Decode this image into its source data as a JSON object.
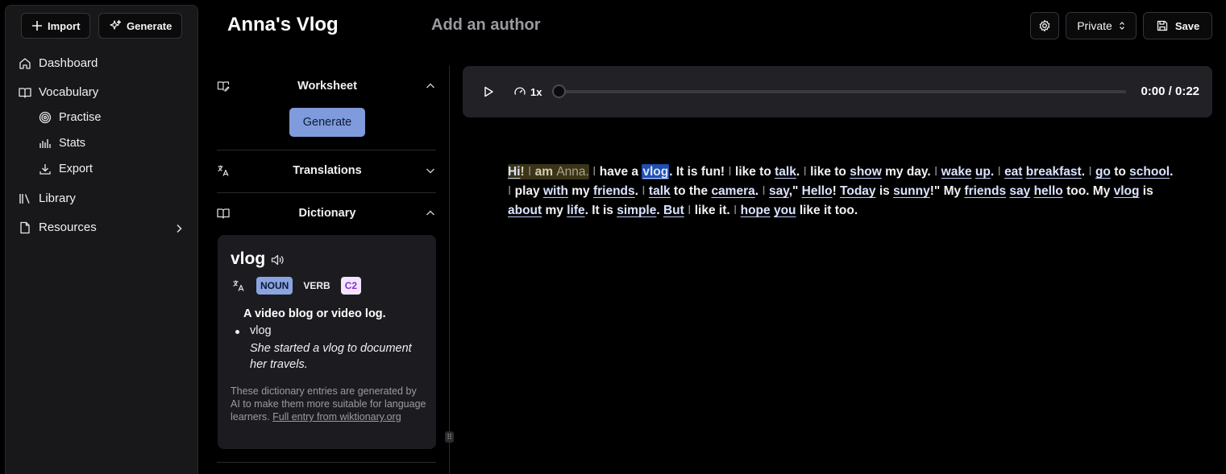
{
  "sidebar": {
    "import_label": "Import",
    "generate_label": "Generate",
    "items": [
      {
        "label": "Dashboard"
      },
      {
        "label": "Vocabulary"
      },
      {
        "label": "Practise"
      },
      {
        "label": "Stats"
      },
      {
        "label": "Export"
      },
      {
        "label": "Library"
      },
      {
        "label": "Resources"
      }
    ]
  },
  "header": {
    "title": "Anna's Vlog",
    "author_placeholder": "Add an author",
    "visibility": "Private",
    "save_label": "Save"
  },
  "panel": {
    "worksheet_label": "Worksheet",
    "worksheet_button": "Generate",
    "translations_label": "Translations",
    "dictionary_label": "Dictionary"
  },
  "dictionary": {
    "word": "vlog",
    "pos": [
      "NOUN",
      "VERB"
    ],
    "level": "C2",
    "definition": "A video blog or video log.",
    "example_word": "vlog",
    "example_sentence": "She started a vlog to document her travels.",
    "note": "These dictionary entries are generated by AI to make them more suitable for language learners. ",
    "link": "Full entry from wiktionary.org"
  },
  "player": {
    "speed": "1x",
    "progress": 0,
    "time": "0:00 / 0:22"
  },
  "colors": {
    "accent": "#7f9bdc",
    "level_badge": "#8b2bd6",
    "selected_word": "#1d4fb0",
    "highlight_segment": "#3a3418"
  },
  "transcript": [
    {
      "t": "Hi",
      "v": true,
      "hl": true
    },
    {
      "t": "! ",
      "hl": true
    },
    {
      "t": "I ",
      "sep": true,
      "hl": true
    },
    {
      "t": "am ",
      "hl": true
    },
    {
      "t": "Anna.",
      "hl": true,
      "dim": true
    },
    {
      "t": " "
    },
    {
      "t": "I ",
      "sep": true
    },
    {
      "t": "have a "
    },
    {
      "t": "vlog",
      "v": true,
      "sel": true
    },
    {
      "t": ". It is fun! "
    },
    {
      "t": "I ",
      "sep": true
    },
    {
      "t": "like to "
    },
    {
      "t": "talk",
      "v": true
    },
    {
      "t": ". "
    },
    {
      "t": "I ",
      "sep": true
    },
    {
      "t": "like to "
    },
    {
      "t": "show",
      "v": true
    },
    {
      "t": " my day. "
    },
    {
      "t": "I ",
      "sep": true
    },
    {
      "t": "wake",
      "v": true
    },
    {
      "t": " "
    },
    {
      "t": "up",
      "v": true
    },
    {
      "t": ". "
    },
    {
      "t": "I ",
      "sep": true
    },
    {
      "t": "eat",
      "v": true
    },
    {
      "t": " "
    },
    {
      "t": "breakfast",
      "v": true
    },
    {
      "t": ". "
    },
    {
      "t": "I ",
      "sep": true
    },
    {
      "t": "go",
      "v": true
    },
    {
      "t": " to "
    },
    {
      "t": "school",
      "v": true
    },
    {
      "t": ". "
    },
    {
      "t": "I ",
      "sep": true
    },
    {
      "t": "play "
    },
    {
      "t": "with",
      "v": true
    },
    {
      "t": " my "
    },
    {
      "t": "friends",
      "v": true
    },
    {
      "t": ". "
    },
    {
      "t": "I ",
      "sep": true
    },
    {
      "t": "talk",
      "v": true
    },
    {
      "t": " to the "
    },
    {
      "t": "camera",
      "v": true
    },
    {
      "t": ". "
    },
    {
      "t": "I ",
      "sep": true
    },
    {
      "t": "say",
      "v": true
    },
    {
      "t": ",\" "
    },
    {
      "t": "Hello",
      "v": true
    },
    {
      "t": "! "
    },
    {
      "t": "Today",
      "v": true
    },
    {
      "t": " is "
    },
    {
      "t": "sunny",
      "v": true
    },
    {
      "t": "!\" My "
    },
    {
      "t": "friends",
      "v": true
    },
    {
      "t": " "
    },
    {
      "t": "say",
      "v": true
    },
    {
      "t": " "
    },
    {
      "t": "hello",
      "v": true
    },
    {
      "t": " too. My "
    },
    {
      "t": "vlog",
      "v": true
    },
    {
      "t": " is "
    },
    {
      "t": "about",
      "v": true
    },
    {
      "t": " my "
    },
    {
      "t": "life",
      "v": true
    },
    {
      "t": ". It is "
    },
    {
      "t": "simple",
      "v": true
    },
    {
      "t": ". "
    },
    {
      "t": "But",
      "v": true
    },
    {
      "t": " "
    },
    {
      "t": "I ",
      "sep": true
    },
    {
      "t": "like it. "
    },
    {
      "t": "I ",
      "sep": true
    },
    {
      "t": "hope",
      "v": true
    },
    {
      "t": " "
    },
    {
      "t": "you",
      "v": true
    },
    {
      "t": " like it too."
    }
  ]
}
